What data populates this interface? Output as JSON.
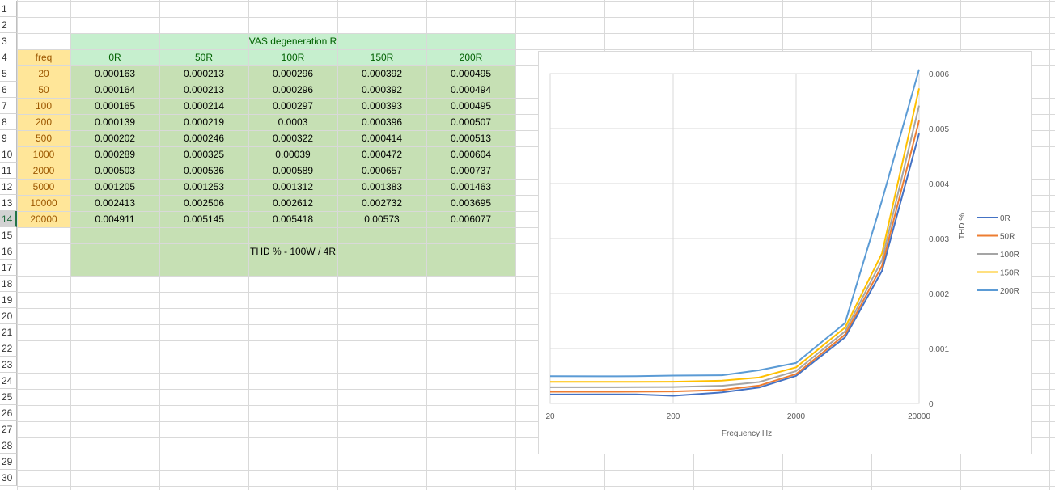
{
  "row_headers": [
    "1",
    "2",
    "3",
    "4",
    "5",
    "6",
    "7",
    "8",
    "9",
    "10",
    "11",
    "12",
    "13",
    "14",
    "15",
    "16",
    "17",
    "18",
    "19",
    "20",
    "21",
    "22",
    "23",
    "24",
    "25",
    "26",
    "27",
    "28",
    "29",
    "30"
  ],
  "table": {
    "group_header": "VAS degeneration R",
    "freq_header": "freq",
    "columns": [
      "0R",
      "50R",
      "100R",
      "150R",
      "200R"
    ],
    "rows": [
      {
        "freq": "20",
        "values": [
          "0.000163",
          "0.000213",
          "0.000296",
          "0.000392",
          "0.000495"
        ]
      },
      {
        "freq": "50",
        "values": [
          "0.000164",
          "0.000213",
          "0.000296",
          "0.000392",
          "0.000494"
        ]
      },
      {
        "freq": "100",
        "values": [
          "0.000165",
          "0.000214",
          "0.000297",
          "0.000393",
          "0.000495"
        ]
      },
      {
        "freq": "200",
        "values": [
          "0.000139",
          "0.000219",
          "0.0003",
          "0.000396",
          "0.000507"
        ]
      },
      {
        "freq": "500",
        "values": [
          "0.000202",
          "0.000246",
          "0.000322",
          "0.000414",
          "0.000513"
        ]
      },
      {
        "freq": "1000",
        "values": [
          "0.000289",
          "0.000325",
          "0.00039",
          "0.000472",
          "0.000604"
        ]
      },
      {
        "freq": "2000",
        "values": [
          "0.000503",
          "0.000536",
          "0.000589",
          "0.000657",
          "0.000737"
        ]
      },
      {
        "freq": "5000",
        "values": [
          "0.001205",
          "0.001253",
          "0.001312",
          "0.001383",
          "0.001463"
        ]
      },
      {
        "freq": "10000",
        "values": [
          "0.002413",
          "0.002506",
          "0.002612",
          "0.002732",
          "0.003695"
        ]
      },
      {
        "freq": "20000",
        "values": [
          "0.004911",
          "0.005145",
          "0.005418",
          "0.00573",
          "0.006077"
        ]
      }
    ],
    "caption": "THD % - 100W / 4R"
  },
  "colors": {
    "header_green": "#c6efce",
    "body_green": "#c6e0b4",
    "freq_orange": "#ffe699",
    "series": [
      "#4472c4",
      "#ed7d31",
      "#a5a5a5",
      "#ffc000",
      "#5b9bd5"
    ]
  },
  "chart_data": {
    "type": "line",
    "x": [
      20,
      50,
      100,
      200,
      500,
      1000,
      2000,
      5000,
      10000,
      20000
    ],
    "x_scale": "log",
    "x_ticks": [
      "20",
      "200",
      "2000",
      "20000"
    ],
    "xlabel": "Frequency Hz",
    "ylabel": "THD %",
    "ylim": [
      0,
      0.006
    ],
    "y_ticks": [
      "0",
      "0.001",
      "0.002",
      "0.003",
      "0.004",
      "0.005",
      "0.006"
    ],
    "y_axis_side": "right",
    "grid": true,
    "legend": "right",
    "series": [
      {
        "name": "0R",
        "values": [
          0.000163,
          0.000164,
          0.000165,
          0.000139,
          0.000202,
          0.000289,
          0.000503,
          0.001205,
          0.002413,
          0.004911
        ]
      },
      {
        "name": "50R",
        "values": [
          0.000213,
          0.000213,
          0.000214,
          0.000219,
          0.000246,
          0.000325,
          0.000536,
          0.001253,
          0.002506,
          0.005145
        ]
      },
      {
        "name": "100R",
        "values": [
          0.000296,
          0.000296,
          0.000297,
          0.0003,
          0.000322,
          0.00039,
          0.000589,
          0.001312,
          0.002612,
          0.005418
        ]
      },
      {
        "name": "150R",
        "values": [
          0.000392,
          0.000392,
          0.000393,
          0.000396,
          0.000414,
          0.000472,
          0.000657,
          0.001383,
          0.002732,
          0.00573
        ]
      },
      {
        "name": "200R",
        "values": [
          0.000495,
          0.000494,
          0.000495,
          0.000507,
          0.000513,
          0.000604,
          0.000737,
          0.001463,
          0.003695,
          0.006077
        ]
      }
    ]
  }
}
